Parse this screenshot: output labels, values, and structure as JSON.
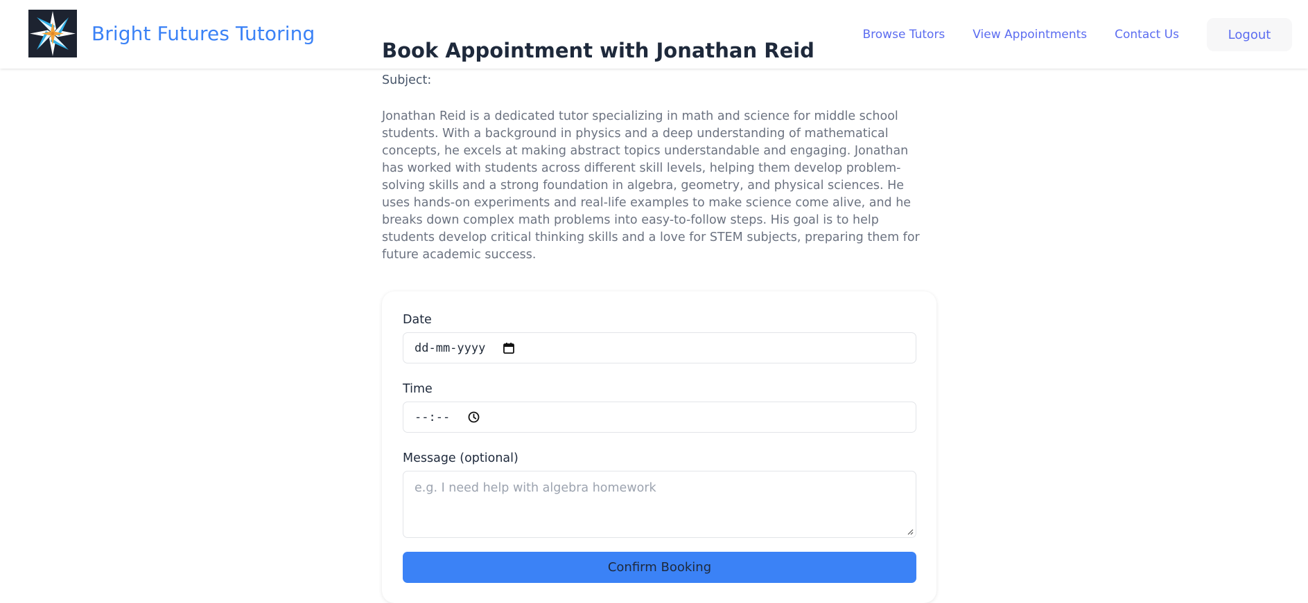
{
  "brand": {
    "name": "Bright Futures Tutoring",
    "logo_icon": "compass-star-icon",
    "color": "#3b82f6"
  },
  "nav": {
    "links": [
      "Browse Tutors",
      "View Appointments",
      "Contact Us"
    ],
    "logout_label": "Logout",
    "link_color": "#5b6cf0"
  },
  "page": {
    "title": "Book Appointment with Jonathan Reid",
    "subject_label": "Subject:",
    "bio": "Jonathan Reid is a dedicated tutor specializing in math and science for middle school students. With a background in physics and a deep understanding of mathematical concepts, he excels at making abstract topics understandable and engaging. Jonathan has worked with students across different skill levels, helping them develop problem-solving skills and a strong foundation in algebra, geometry, and physical sciences. He uses hands-on experiments and real-life examples to make science come alive, and he breaks down complex math problems into easy-to-follow steps. His goal is to help students develop critical thinking skills and a love for STEM subjects, preparing them for future academic success."
  },
  "form": {
    "date_label": "Date",
    "date_value": "dd-mm-yyyy",
    "date_icon": "calendar-icon",
    "time_label": "Time",
    "time_value": "--:--",
    "time_icon": "clock-icon",
    "message_label": "Message (optional)",
    "message_placeholder": "e.g. I need help with algebra homework",
    "confirm_label": "Confirm Booking",
    "button_color": "#3b82f6"
  }
}
